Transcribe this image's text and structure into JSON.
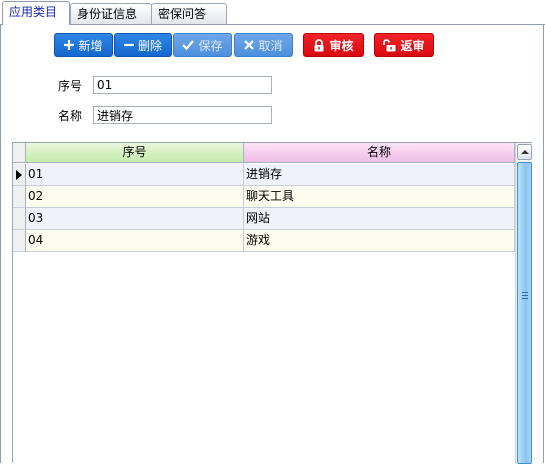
{
  "tabs": [
    {
      "label": "应用类目",
      "active": true
    },
    {
      "label": "身份证信息",
      "active": false
    },
    {
      "label": "密保问答",
      "active": false
    }
  ],
  "toolbar": {
    "add_label": "新增",
    "delete_label": "删除",
    "save_label": "保存",
    "cancel_label": "取消",
    "audit_label": "审核",
    "unaudit_label": "返审"
  },
  "form": {
    "seq_label": "序号",
    "seq_value": "01",
    "name_label": "名称",
    "name_value": "进销存"
  },
  "grid": {
    "columns": [
      "序号",
      "名称"
    ],
    "rows": [
      {
        "seq": "01",
        "name": "进销存",
        "current": true
      },
      {
        "seq": "02",
        "name": "聊天工具",
        "current": false
      },
      {
        "seq": "03",
        "name": "网站",
        "current": false
      },
      {
        "seq": "04",
        "name": "游戏",
        "current": false
      }
    ]
  },
  "colors": {
    "blue_button": "#1a73d8",
    "red_button": "#e6141c",
    "header_col1": "#c4ecab",
    "header_col2": "#f0bde7",
    "active_tab_text": "#1a2aa8"
  }
}
